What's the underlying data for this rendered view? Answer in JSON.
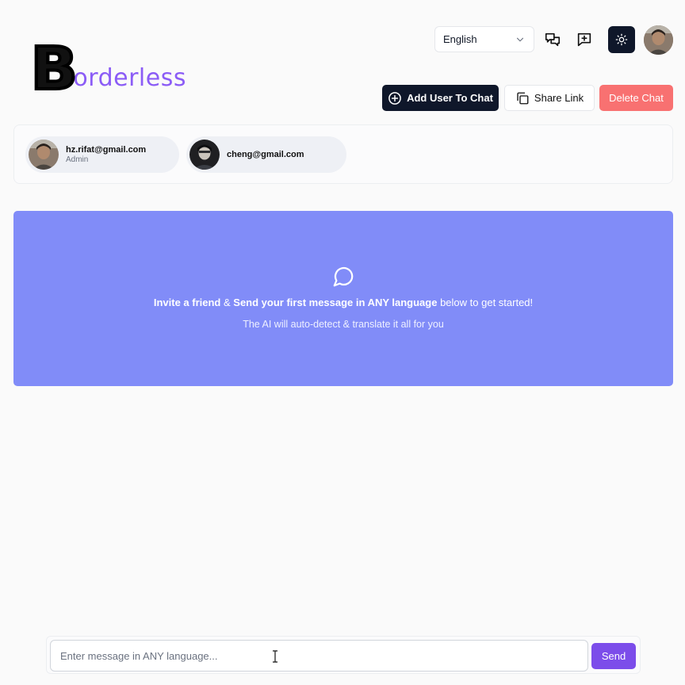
{
  "app": {
    "logo_letter": "B",
    "logo_rest": "orderless"
  },
  "header": {
    "language": "English",
    "buttons": {
      "add_user": "Add User To Chat",
      "share_link": "Share Link",
      "delete_chat": "Delete Chat"
    }
  },
  "members": [
    {
      "email": "hz.rifat@gmail.com",
      "role": "Admin"
    },
    {
      "email": "cheng@gmail.com",
      "role": ""
    }
  ],
  "banner": {
    "line1_bold_a": "Invite a friend",
    "line1_amp": " & ",
    "line1_bold_b": "Send your first message in ANY language",
    "line1_rest": " below to get started!",
    "line2": "The AI will auto-detect & translate it all for you"
  },
  "composer": {
    "placeholder": "Enter message in ANY language...",
    "send_label": "Send"
  },
  "colors": {
    "brand_purple": "#8b5cf6",
    "banner": "#818cf8",
    "send": "#7c4dea",
    "delete": "#f87171",
    "dark": "#0f172a"
  }
}
